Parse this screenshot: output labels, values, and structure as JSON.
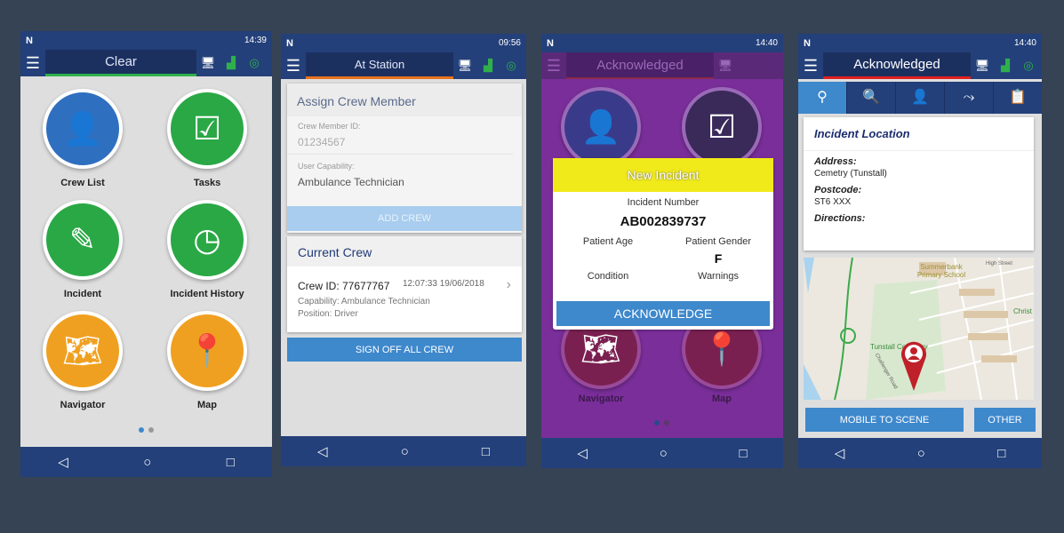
{
  "screens": [
    {
      "time": "14:39",
      "network": "4G",
      "status_text": "Clear",
      "tiles": [
        {
          "label": "Crew List",
          "icon": "add-user-icon",
          "color": "#2f6fc0"
        },
        {
          "label": "Tasks",
          "icon": "tasks-checklist-icon",
          "color": "#2aa845"
        },
        {
          "label": "Incident",
          "icon": "incident-form-icon",
          "color": "#2aa845"
        },
        {
          "label": "Incident History",
          "icon": "incident-history-icon",
          "color": "#2aa845"
        },
        {
          "label": "Navigator",
          "icon": "navigator-map-icon",
          "color": "#f0a020"
        },
        {
          "label": "Map",
          "icon": "map-icon",
          "color": "#f0a020"
        }
      ]
    },
    {
      "time": "09:56",
      "network": "4G",
      "status_text": "At Station",
      "assign": {
        "title": "Assign Crew Member",
        "id_label": "Crew Member ID:",
        "id_placeholder": "01234567",
        "capability_label": "User Capability:",
        "capability_value": "Ambulance Technician",
        "add_button": "ADD CREW"
      },
      "current": {
        "title": "Current Crew",
        "crew_id": "Crew ID: 77677767",
        "timestamp": "12:07:33 19/06/2018",
        "capability": "Capability: Ambulance Technician",
        "position": "Position: Driver",
        "sign_off_button": "SIGN OFF ALL CREW"
      }
    },
    {
      "time": "14:40",
      "network": "4G",
      "status_text": "Acknowledged",
      "tile_labels": [
        "Navigator",
        "Map"
      ],
      "dialog": {
        "title": "New Incident",
        "number_label": "Incident Number",
        "number": "AB002839737",
        "age_label": "Patient Age",
        "age": "",
        "gender_label": "Patient Gender",
        "gender": "F",
        "condition_label": "Condition",
        "warnings_label": "Warnings",
        "button": "ACKNOWLEDGE"
      }
    },
    {
      "time": "14:40",
      "network": "4G",
      "status_text": "Acknowledged",
      "tabs": [
        "location-pin-icon",
        "patient-search-icon",
        "patient-card-icon",
        "route-icon",
        "clipboard-icon"
      ],
      "location": {
        "title": "Incident Location",
        "address_label": "Address:",
        "address": "Cemetry (Tunstall)",
        "postcode_label": "Postcode:",
        "postcode": "ST6 XXX",
        "directions_label": "Directions:"
      },
      "map_labels": [
        "Summerbank Primary School",
        "High Street",
        "Christ C",
        "Tunstall Cemetery",
        "Challenger Road"
      ],
      "buttons": {
        "mobile": "MOBILE TO SCENE",
        "other": "OTHER"
      }
    }
  ],
  "colors": {
    "brand": "#23407a",
    "purple": "#7a2e9a",
    "yellow": "#f1ea1a",
    "accent_blue": "#3e88cc"
  }
}
